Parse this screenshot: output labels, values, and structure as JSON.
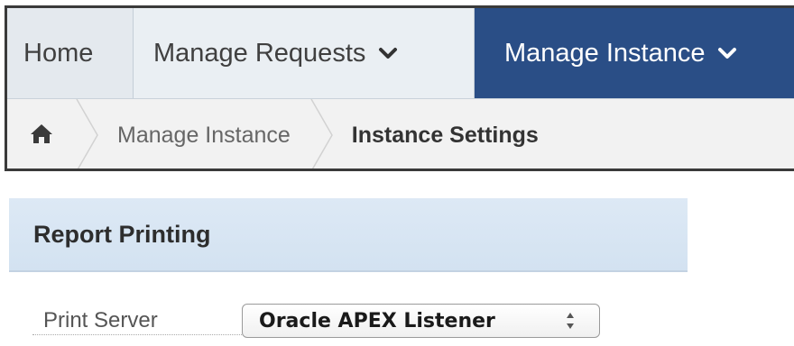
{
  "topnav": {
    "tabs": [
      {
        "label": "Home"
      },
      {
        "label": "Manage Requests"
      },
      {
        "label": "Manage Instance"
      }
    ],
    "active_tab_color": "#2a4e86"
  },
  "breadcrumb": {
    "home_icon": "home-icon",
    "items": [
      {
        "label": "Manage Instance"
      },
      {
        "label": "Instance Settings"
      }
    ]
  },
  "region": {
    "title": "Report Printing"
  },
  "form": {
    "print_server": {
      "label": "Print Server",
      "value": "Oracle APEX Listener"
    }
  }
}
